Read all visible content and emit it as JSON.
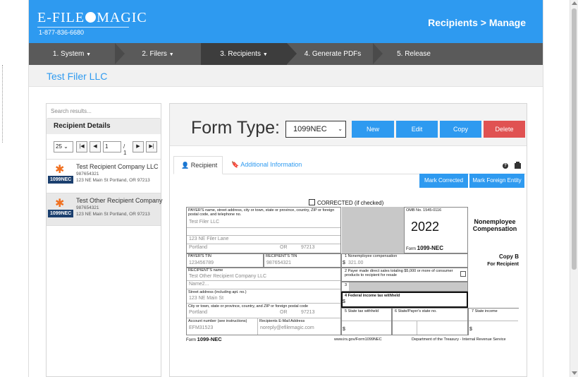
{
  "brand": {
    "name_left": "E-FILE",
    "name_right": "MAGIC",
    "phone": "1-877-836-6680"
  },
  "header": {
    "title": "Recipients > Manage"
  },
  "steps": [
    {
      "label": "1. System",
      "caret": "▼"
    },
    {
      "label": "2. Filers",
      "caret": "▼"
    },
    {
      "label": "3. Recipients",
      "caret": "▼"
    },
    {
      "label": "4. Generate PDFs",
      "caret": ""
    },
    {
      "label": "5. Release",
      "caret": ""
    }
  ],
  "filer": {
    "name": "Test Filer LLC"
  },
  "sidebar": {
    "search_placeholder": "Search results...",
    "title": "Recipient Details",
    "page_size": "25",
    "page": "1",
    "page_total": "/ 1",
    "pager_first": "|◀",
    "pager_prev": "◀",
    "pager_next": "▶",
    "pager_last": "▶|",
    "dd": "⌄",
    "star": "✱",
    "records": [
      {
        "name": "Test Recipient Company LLC",
        "tin": "987654321",
        "badge": "1099NEC",
        "address": "123 NE Main St Portland, OR 97213"
      },
      {
        "name": "Test Other Recipient Company",
        "tin": "987654321",
        "badge": "1099NEC",
        "address": "123 NE Main St Portland, OR 97213"
      }
    ]
  },
  "main": {
    "form_type_label": "Form Type:",
    "form_type_value": "1099NEC",
    "dd": "⌄",
    "buttons": {
      "new": "New",
      "edit": "Edit",
      "copy": "Copy",
      "delete": "Delete"
    },
    "tabs": {
      "recipient": "Recipient",
      "additional": "Additional Information",
      "recipient_icon": "👤",
      "additional_icon": "🔖"
    },
    "help": "?",
    "mark_corrected": "Mark Corrected",
    "mark_foreign": "Mark Foreign Entity"
  },
  "form": {
    "corrected": "CORRECTED (if checked)",
    "payer_label": "PAYER'S name, street address, city or town, state or province, country, ZIP or foreign postal code, and telephone no.",
    "payer_name": "Test Filer LLC",
    "payer_street": "123 NE Filer Lane",
    "payer_city": "Portland",
    "payer_state": "OR",
    "payer_zip": "97213",
    "omb": "OMB No. 1545-0116",
    "year": "2022",
    "form_prefix": "Form",
    "form_name": "1099-NEC",
    "title_line1": "Nonemployee",
    "title_line2": "Compensation",
    "payer_tin_label": "PAYER'S TIN",
    "payer_tin": "123456789",
    "recipient_tin_label": "RECIPIENT'S TIN",
    "recipient_tin": "987654321",
    "box1_label": "1 Nonemployee compensation",
    "box1_value": "321.00",
    "dollar": "$",
    "copy_b": "Copy B",
    "for_recipient": "For Recipient",
    "recipient_name_label": "RECIPIENT'S name",
    "recipient_name": "Test Other Recipient Company LLC",
    "recipient_name2": "Name2...",
    "box2_label": "2 Payer made direct sales totaling $5,000 or more of consumer products to recipient for resale",
    "box3_label": "3",
    "street_label": "Street address (including apt. no.)",
    "recipient_street": "123 NE Main St",
    "box4_label": "4 Federal income tax withheld",
    "city_label": "City or town, state or province, country, and ZIP or foreign postal code",
    "recipient_city": "Portland",
    "recipient_state": "OR",
    "recipient_zip": "97213",
    "box5_label": "5 State tax withheld",
    "box6_label": "6 State/Payer's state no.",
    "box7_label": "7 State income",
    "account_label": "Account number (see instructions)",
    "account": "EFM31523",
    "email_label": "Recipients E-Mail Address",
    "email": "noreply@efilemagic.com",
    "footer_form": "1099-NEC",
    "footer_url": "www.irs.gov/Form1099NEC",
    "footer_dept": "Department of the Treasury - Internal Revenue Service"
  },
  "colors": {
    "primary": "#2e9af0",
    "danger": "#e05252",
    "badge": "#1b3f6e",
    "star": "#f07020"
  }
}
